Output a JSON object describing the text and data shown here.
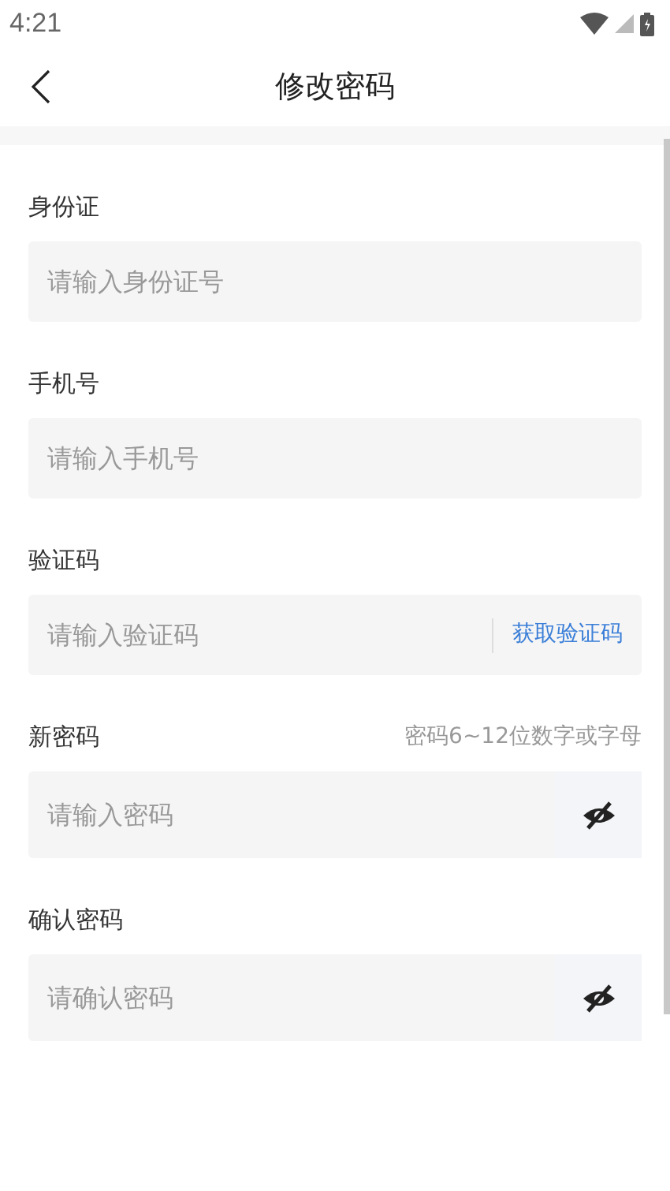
{
  "status_bar": {
    "time": "4:21"
  },
  "header": {
    "title": "修改密码"
  },
  "fields": [
    {
      "kind": "plain",
      "label": "身份证",
      "placeholder": "请输入身份证号"
    },
    {
      "kind": "plain",
      "label": "手机号",
      "placeholder": "请输入手机号"
    },
    {
      "kind": "code",
      "label": "验证码",
      "placeholder": "请输入验证码",
      "action": "获取验证码"
    },
    {
      "kind": "password",
      "label": "新密码",
      "hint": "密码6~12位数字或字母",
      "placeholder": "请输入密码"
    },
    {
      "kind": "password",
      "label": "确认密码",
      "placeholder": "请确认密码"
    }
  ]
}
